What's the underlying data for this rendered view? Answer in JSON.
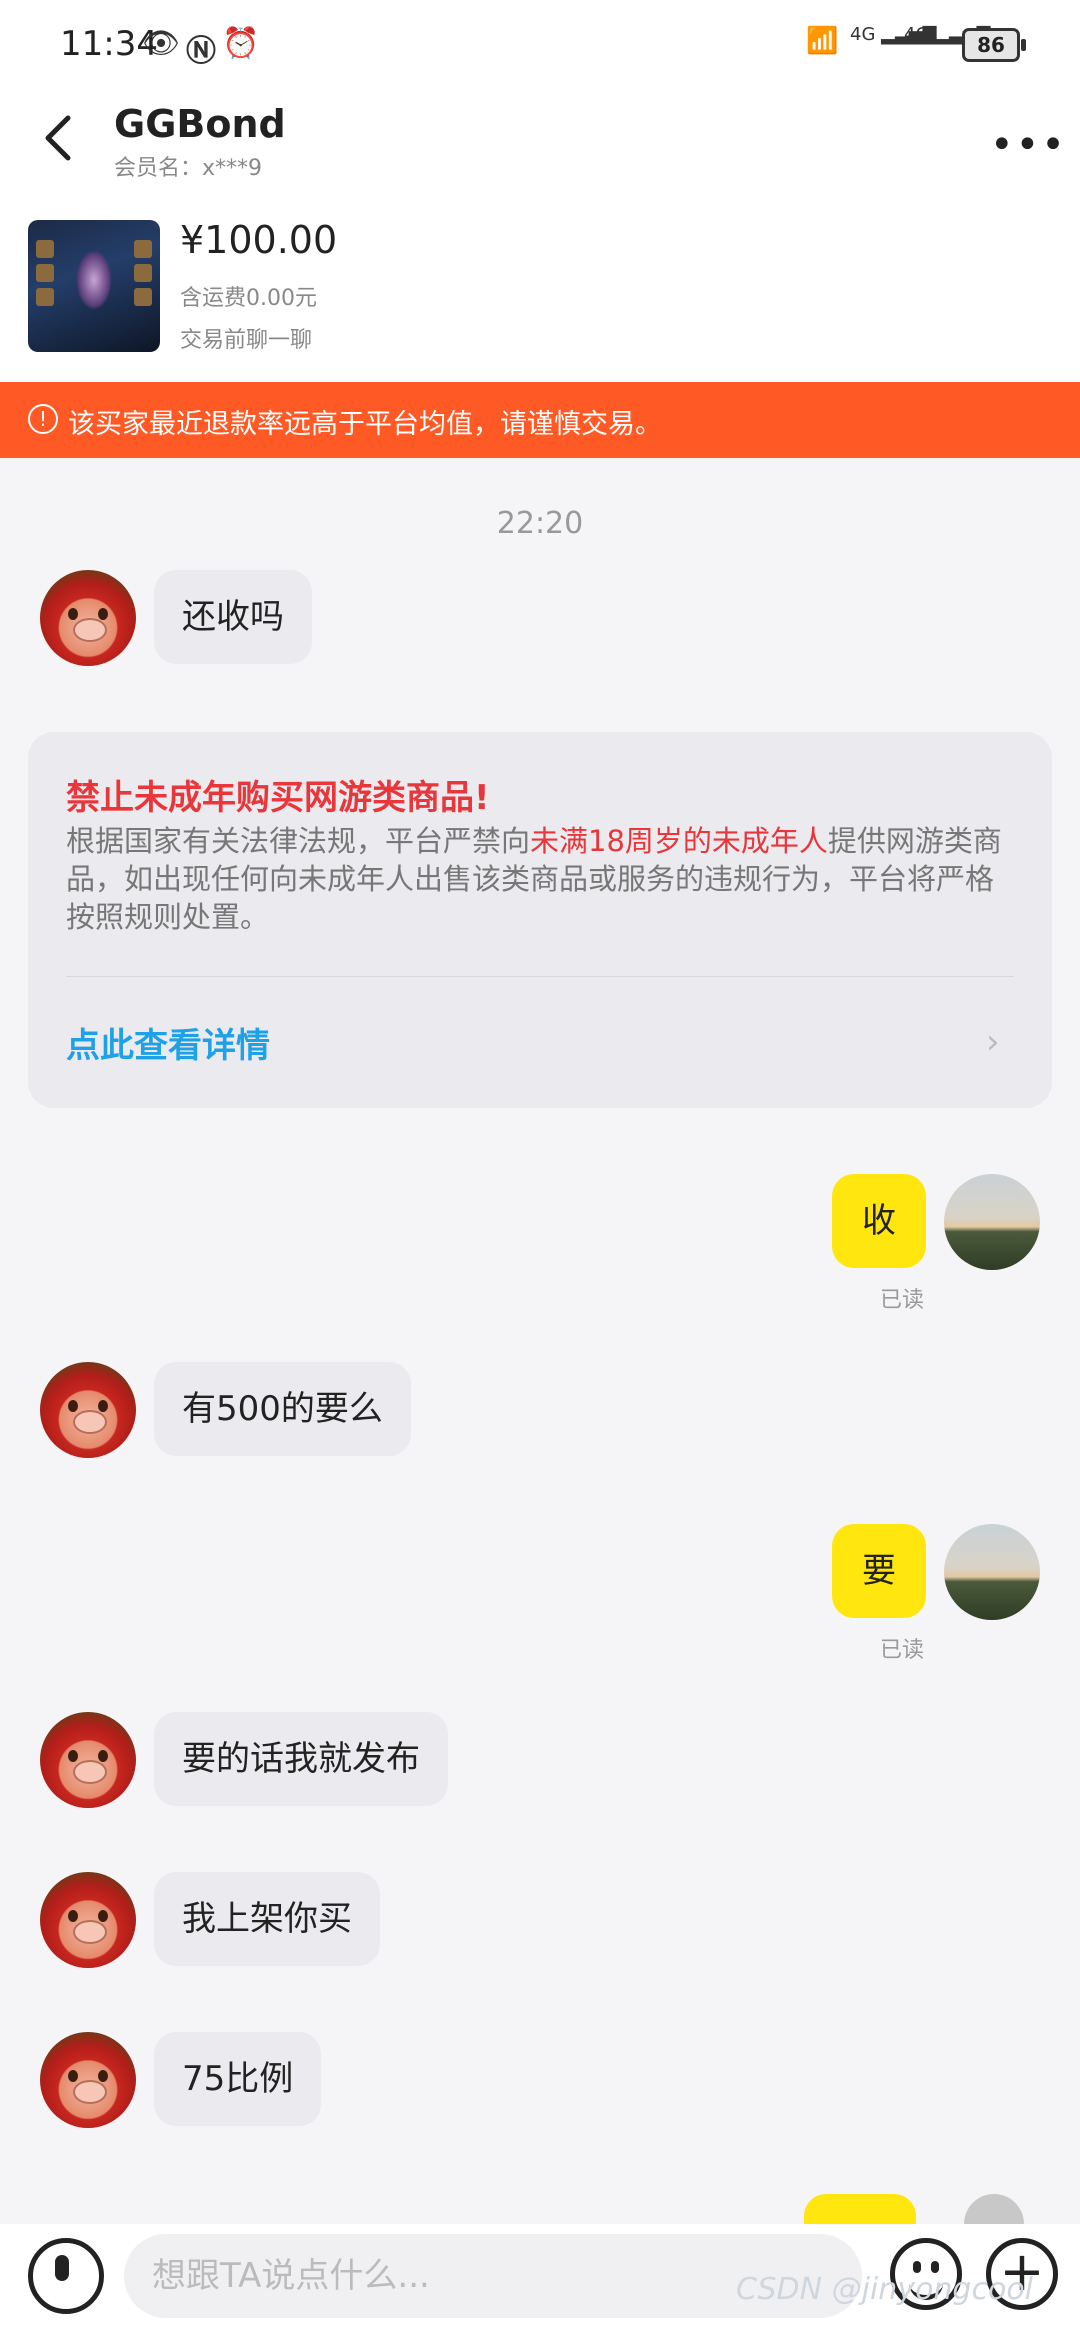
{
  "status_bar": {
    "time": "11:34",
    "battery": "86"
  },
  "header": {
    "title": "GGBond",
    "member_label": "会员名：x***9",
    "more_label": "•••"
  },
  "product": {
    "price": "¥100.00",
    "shipping": "含运费0.00元",
    "chat_hint": "交易前聊一聊"
  },
  "warning": {
    "text": "该买家最近退款率远高于平台均值，请谨慎交易。"
  },
  "timestamp": "22:20",
  "notice": {
    "title": "禁止未成年购买网游类商品!",
    "body_part1": "根据国家有关法律法规，平台严禁向",
    "body_highlight": "未满18周岁的未成年人",
    "body_part2": "提供网游类商品，如出现任何向未成年人出售该类商品或服务的违规行为，平台将严格按照规则处置。",
    "link": "点此查看详情"
  },
  "messages": [
    {
      "side": "left",
      "text": "还收吗"
    },
    {
      "side": "right",
      "text": "收",
      "status": "已读"
    },
    {
      "side": "left",
      "text": "有500的要么"
    },
    {
      "side": "right",
      "text": "要",
      "status": "已读"
    },
    {
      "side": "left",
      "text": "要的话我就发布"
    },
    {
      "side": "left",
      "text": "我上架你买"
    },
    {
      "side": "left",
      "text": "75比例"
    }
  ],
  "input": {
    "placeholder": "想跟TA说点什么..."
  },
  "watermark": "CSDN @jinyongcool",
  "colors": {
    "warning_bg": "#ff5a25",
    "own_bubble": "#ffe60f",
    "notice_red": "#e8363a",
    "link_blue": "#1fa1e8"
  }
}
